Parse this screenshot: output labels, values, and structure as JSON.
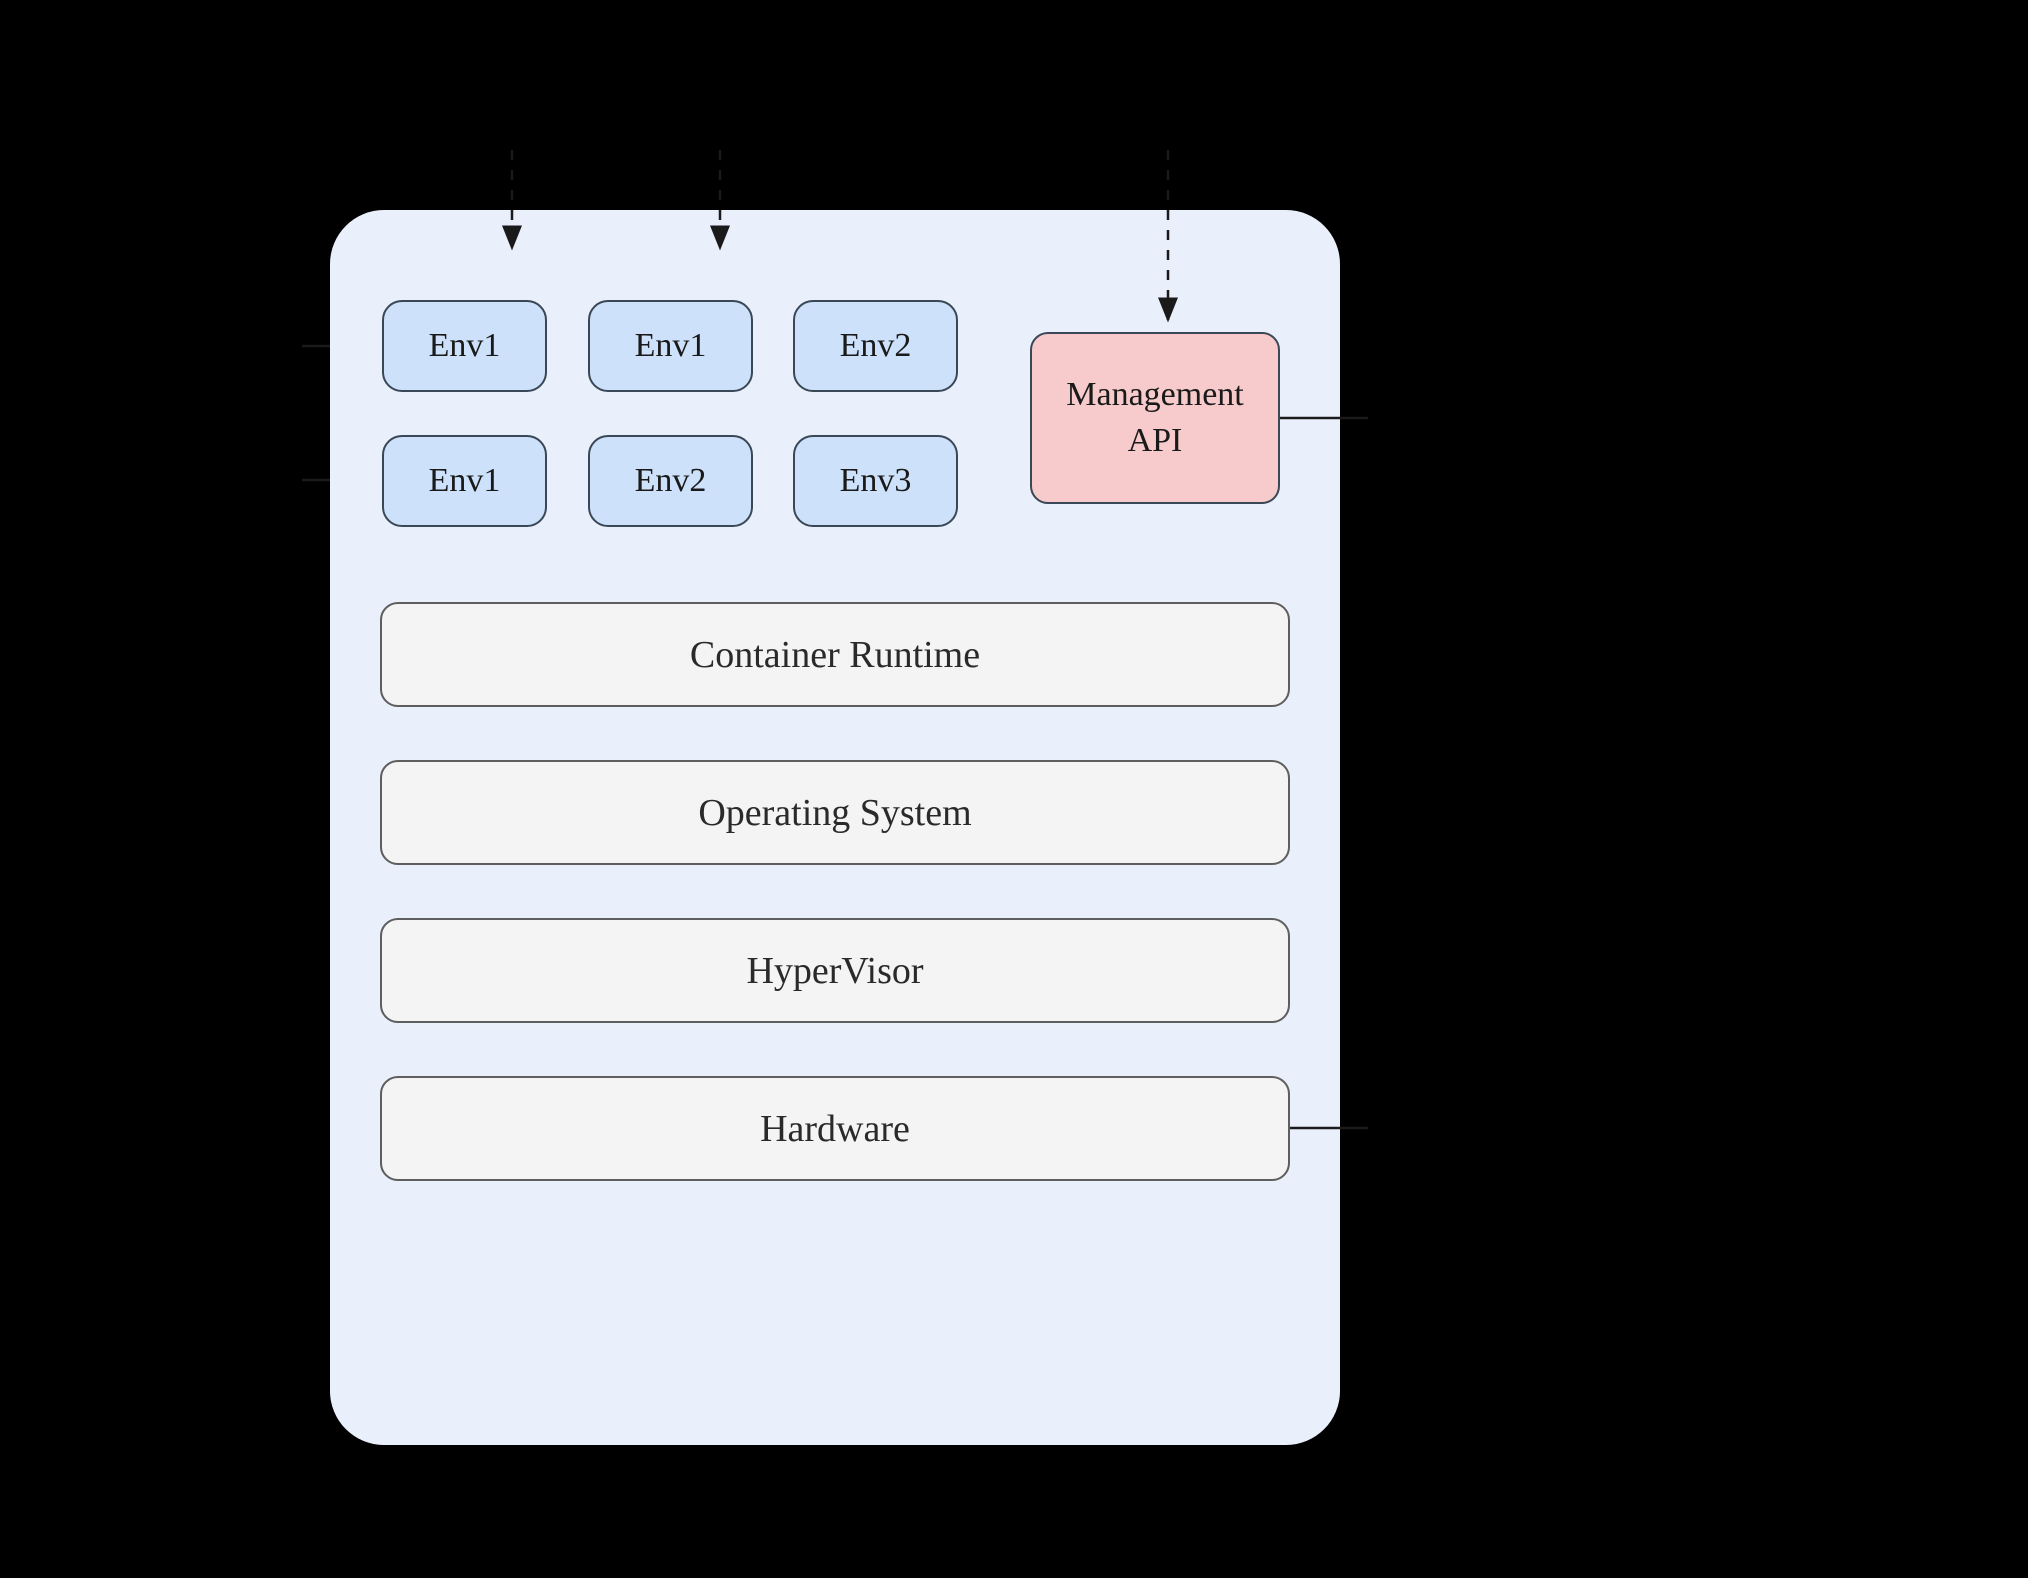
{
  "env_row1": {
    "a": "Env1",
    "b": "Env1",
    "c": "Env2"
  },
  "env_row2": {
    "a": "Env1",
    "b": "Env2",
    "c": "Env3"
  },
  "management": {
    "label": "Management\nAPI"
  },
  "layers": {
    "runtime": "Container Runtime",
    "os": "Operating System",
    "hypervisor": "HyperVisor",
    "hardware": "Hardware"
  },
  "colors": {
    "container_bg": "#E9F0FC",
    "env_bg": "#CDE2FA",
    "mgmt_bg": "#F7CBCB",
    "layer_bg": "#F4F4F4",
    "stroke_dark": "#394756",
    "stroke_gray": "#5E5E5E"
  },
  "diagram": {
    "type": "layered-architecture",
    "description": "Dashed arrows enter from top into two env columns and into the Management API box. Small ticks on the left beside each env row, on the right of the management box, and on the right of the hardware layer."
  }
}
